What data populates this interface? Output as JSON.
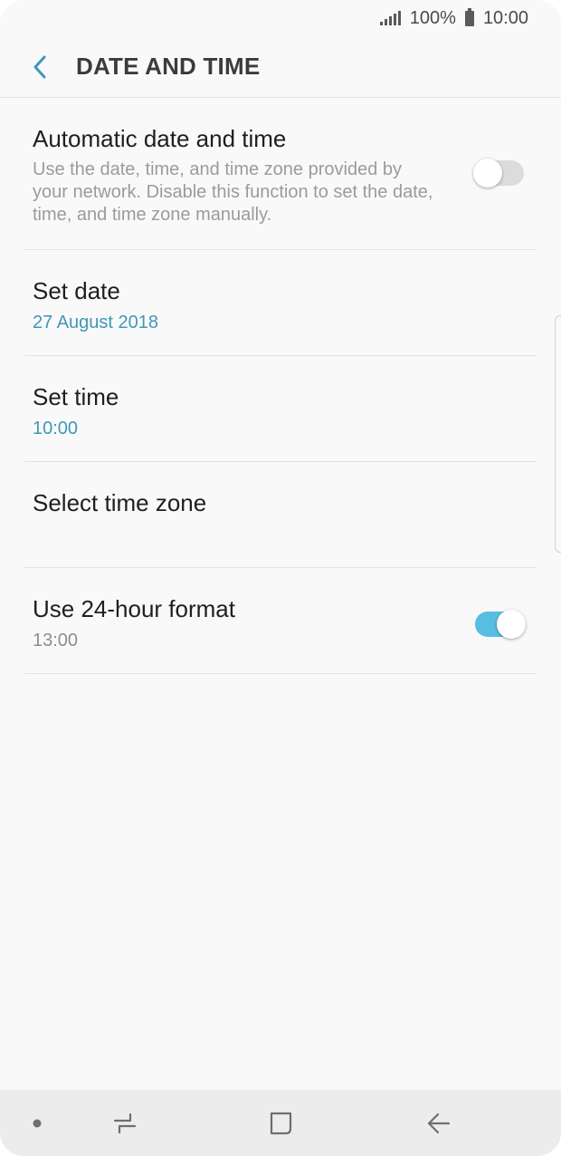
{
  "status_bar": {
    "battery_percent": "100%",
    "clock": "10:00",
    "icons": [
      "signal-icon",
      "battery-icon"
    ]
  },
  "header": {
    "title": "DATE AND TIME",
    "back_icon": "chevron-left-icon"
  },
  "settings": {
    "automatic": {
      "title": "Automatic date and time",
      "description": "Use the date, time, and time zone provided by your network. Disable this function to set the date, time, and time zone manually.",
      "enabled": false
    },
    "set_date": {
      "title": "Set date",
      "value": "27 August 2018"
    },
    "set_time": {
      "title": "Set time",
      "value": "10:00"
    },
    "time_zone": {
      "title": "Select time zone"
    },
    "format_24h": {
      "title": "Use 24-hour format",
      "value": "13:00",
      "enabled": true
    }
  },
  "nav_bar": {
    "icons": [
      "dot-icon",
      "recent-apps-icon",
      "home-icon",
      "back-arrow-icon"
    ]
  },
  "colors": {
    "accent": "#57bde2",
    "link_value": "#3e98b8",
    "background": "#f9f9f9"
  }
}
